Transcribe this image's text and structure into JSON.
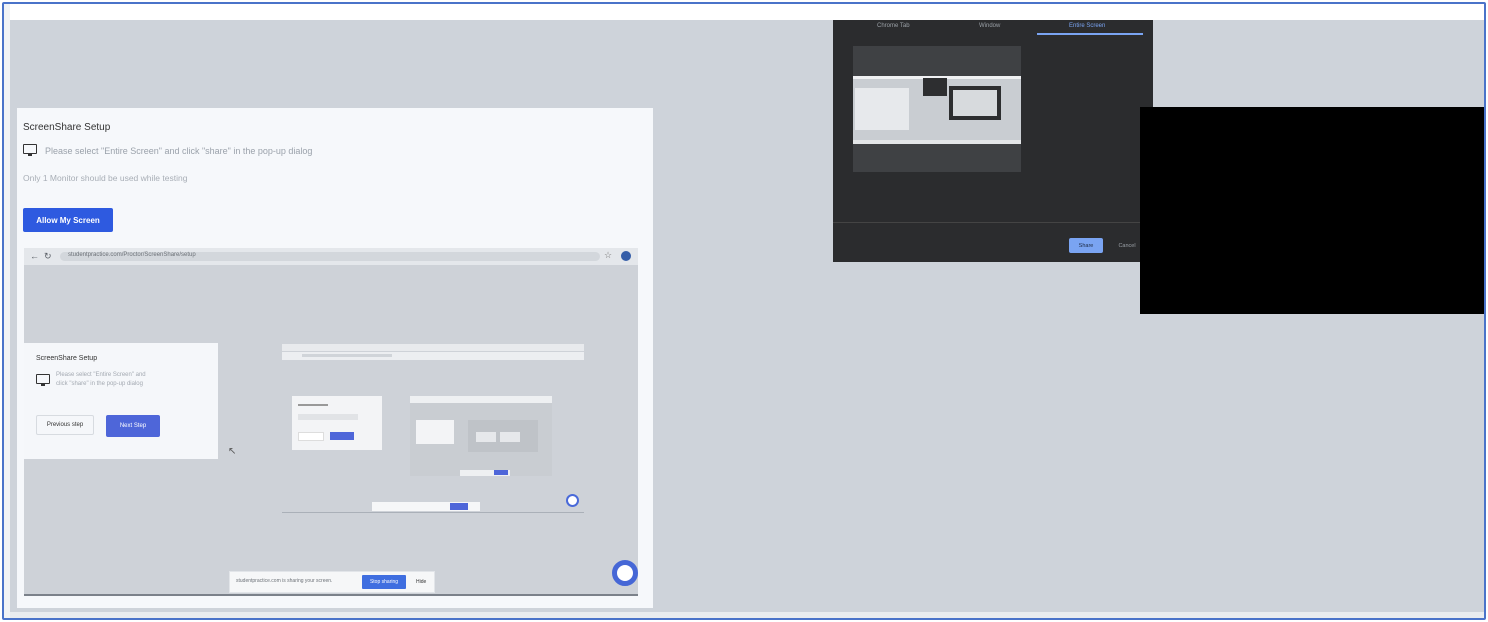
{
  "setup": {
    "title": "ScreenShare Setup",
    "instruction": "Please select \"Entire Screen\" and click \"share\" in the pop-up dialog",
    "note": "Only 1 Monitor should be used while testing",
    "allow_button": "Allow My Screen"
  },
  "browser": {
    "back": "←",
    "reload": "↻",
    "url": "studentpractice.com/Proctor/ScreenShare/setup",
    "star": "☆"
  },
  "inner_card": {
    "title": "ScreenShare Setup",
    "instruction": "Please select \"Entire Screen\" and click \"share\" in the pop-up dialog",
    "previous_button": "Previous step",
    "next_button": "Next Step"
  },
  "share_bar": {
    "message": "studentpractice.com is sharing your screen.",
    "stop_button": "Stop sharing",
    "hide_button": "Hide"
  },
  "dialog": {
    "tabs": [
      "Chrome Tab",
      "Window",
      "Entire Screen"
    ],
    "selected_tab": "Entire Screen",
    "share_button": "Share",
    "cancel_button": "Cancel"
  },
  "colors": {
    "accent": "#2e5ae0",
    "dialog_bg": "#2b2c2e",
    "desktop_bg": "#ced3da",
    "frame_border": "#4a73c9"
  }
}
